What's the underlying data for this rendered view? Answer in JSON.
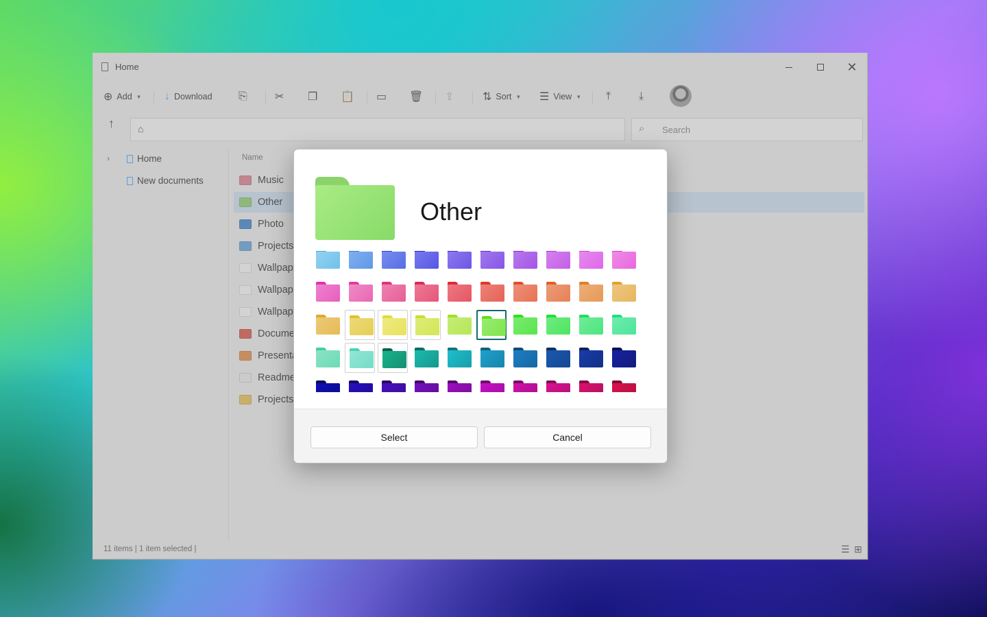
{
  "window": {
    "title": "Home",
    "controls": {
      "minimize": "minimize",
      "maximize": "maximize",
      "close": "✕"
    }
  },
  "toolbar": {
    "add_label": "Add",
    "download_label": "Download",
    "sort_label": "Sort",
    "view_label": "View"
  },
  "search": {
    "placeholder": "Search"
  },
  "sidebar": {
    "items": [
      {
        "label": "Home"
      },
      {
        "label": "New documents"
      }
    ]
  },
  "filelist": {
    "column_name": "Name",
    "rows": [
      {
        "name": "Music",
        "color": "#e07b8c"
      },
      {
        "name": "Other",
        "color": "#8bd36a",
        "selected": true
      },
      {
        "name": "Photo",
        "color": "#2f7fd0"
      },
      {
        "name": "Projects",
        "color": "#5aa0e0"
      },
      {
        "name": "Wallpap",
        "color": "#ffffff"
      },
      {
        "name": "Wallpap",
        "color": "#ffffff"
      },
      {
        "name": "Wallpap",
        "color": "#ffffff"
      },
      {
        "name": "Docume",
        "color": "#e04a3a"
      },
      {
        "name": "Presenta",
        "color": "#e8883a"
      },
      {
        "name": "Readme",
        "color": "#f2f2f2"
      },
      {
        "name": "Projects",
        "color": "#f0c24a"
      }
    ]
  },
  "status": {
    "text": "11 items | 1 item selected |"
  },
  "dialog": {
    "title": "Other",
    "preview_color": "#8bd36a",
    "select_label": "Select",
    "cancel_label": "Cancel",
    "selected_swatch_index": 25
  }
}
